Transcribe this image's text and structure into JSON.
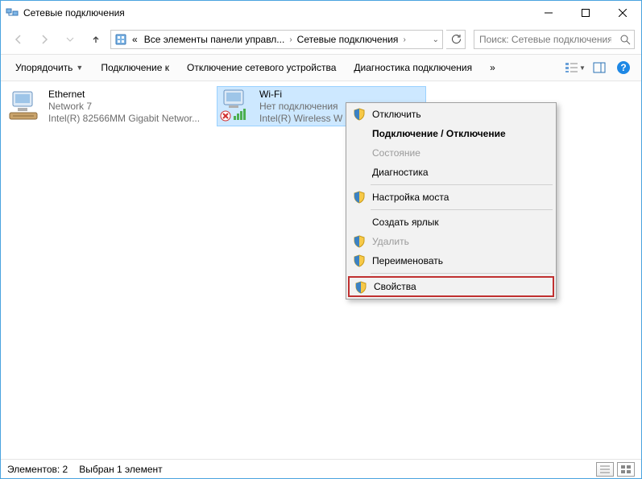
{
  "window": {
    "title": "Сетевые подключения"
  },
  "breadcrumb": {
    "prefix": "«",
    "item1": "Все элементы панели управл...",
    "item2": "Сетевые подключения"
  },
  "search": {
    "placeholder": "Поиск: Сетевые подключения"
  },
  "toolbar": {
    "organize": "Упорядочить",
    "connect": "Подключение к",
    "disable": "Отключение сетевого устройства",
    "diagnose": "Диагностика подключения",
    "more": "»"
  },
  "connections": [
    {
      "name": "Ethernet",
      "line2": "Network  7",
      "line3": "Intel(R) 82566MM Gigabit Networ..."
    },
    {
      "name": "Wi-Fi",
      "line2": "Нет подключения",
      "line3": "Intel(R) Wireless W"
    }
  ],
  "context_menu": {
    "items": [
      {
        "label": "Отключить",
        "shield": true
      },
      {
        "label": "Подключение / Отключение",
        "shield": false,
        "bold": true
      },
      {
        "label": "Состояние",
        "shield": false,
        "disabled": true
      },
      {
        "label": "Диагностика",
        "shield": false
      },
      {
        "sep": true
      },
      {
        "label": "Настройка моста",
        "shield": true
      },
      {
        "sep": true
      },
      {
        "label": "Создать ярлык",
        "shield": false
      },
      {
        "label": "Удалить",
        "shield": true,
        "disabled": true
      },
      {
        "label": "Переименовать",
        "shield": true
      },
      {
        "sep": true
      },
      {
        "label": "Свойства",
        "shield": true,
        "highlight": true
      }
    ]
  },
  "status": {
    "count": "Элементов: 2",
    "selected": "Выбран 1 элемент"
  },
  "colors": {
    "selection": "#cde8ff",
    "highlight_border": "#c03030"
  }
}
